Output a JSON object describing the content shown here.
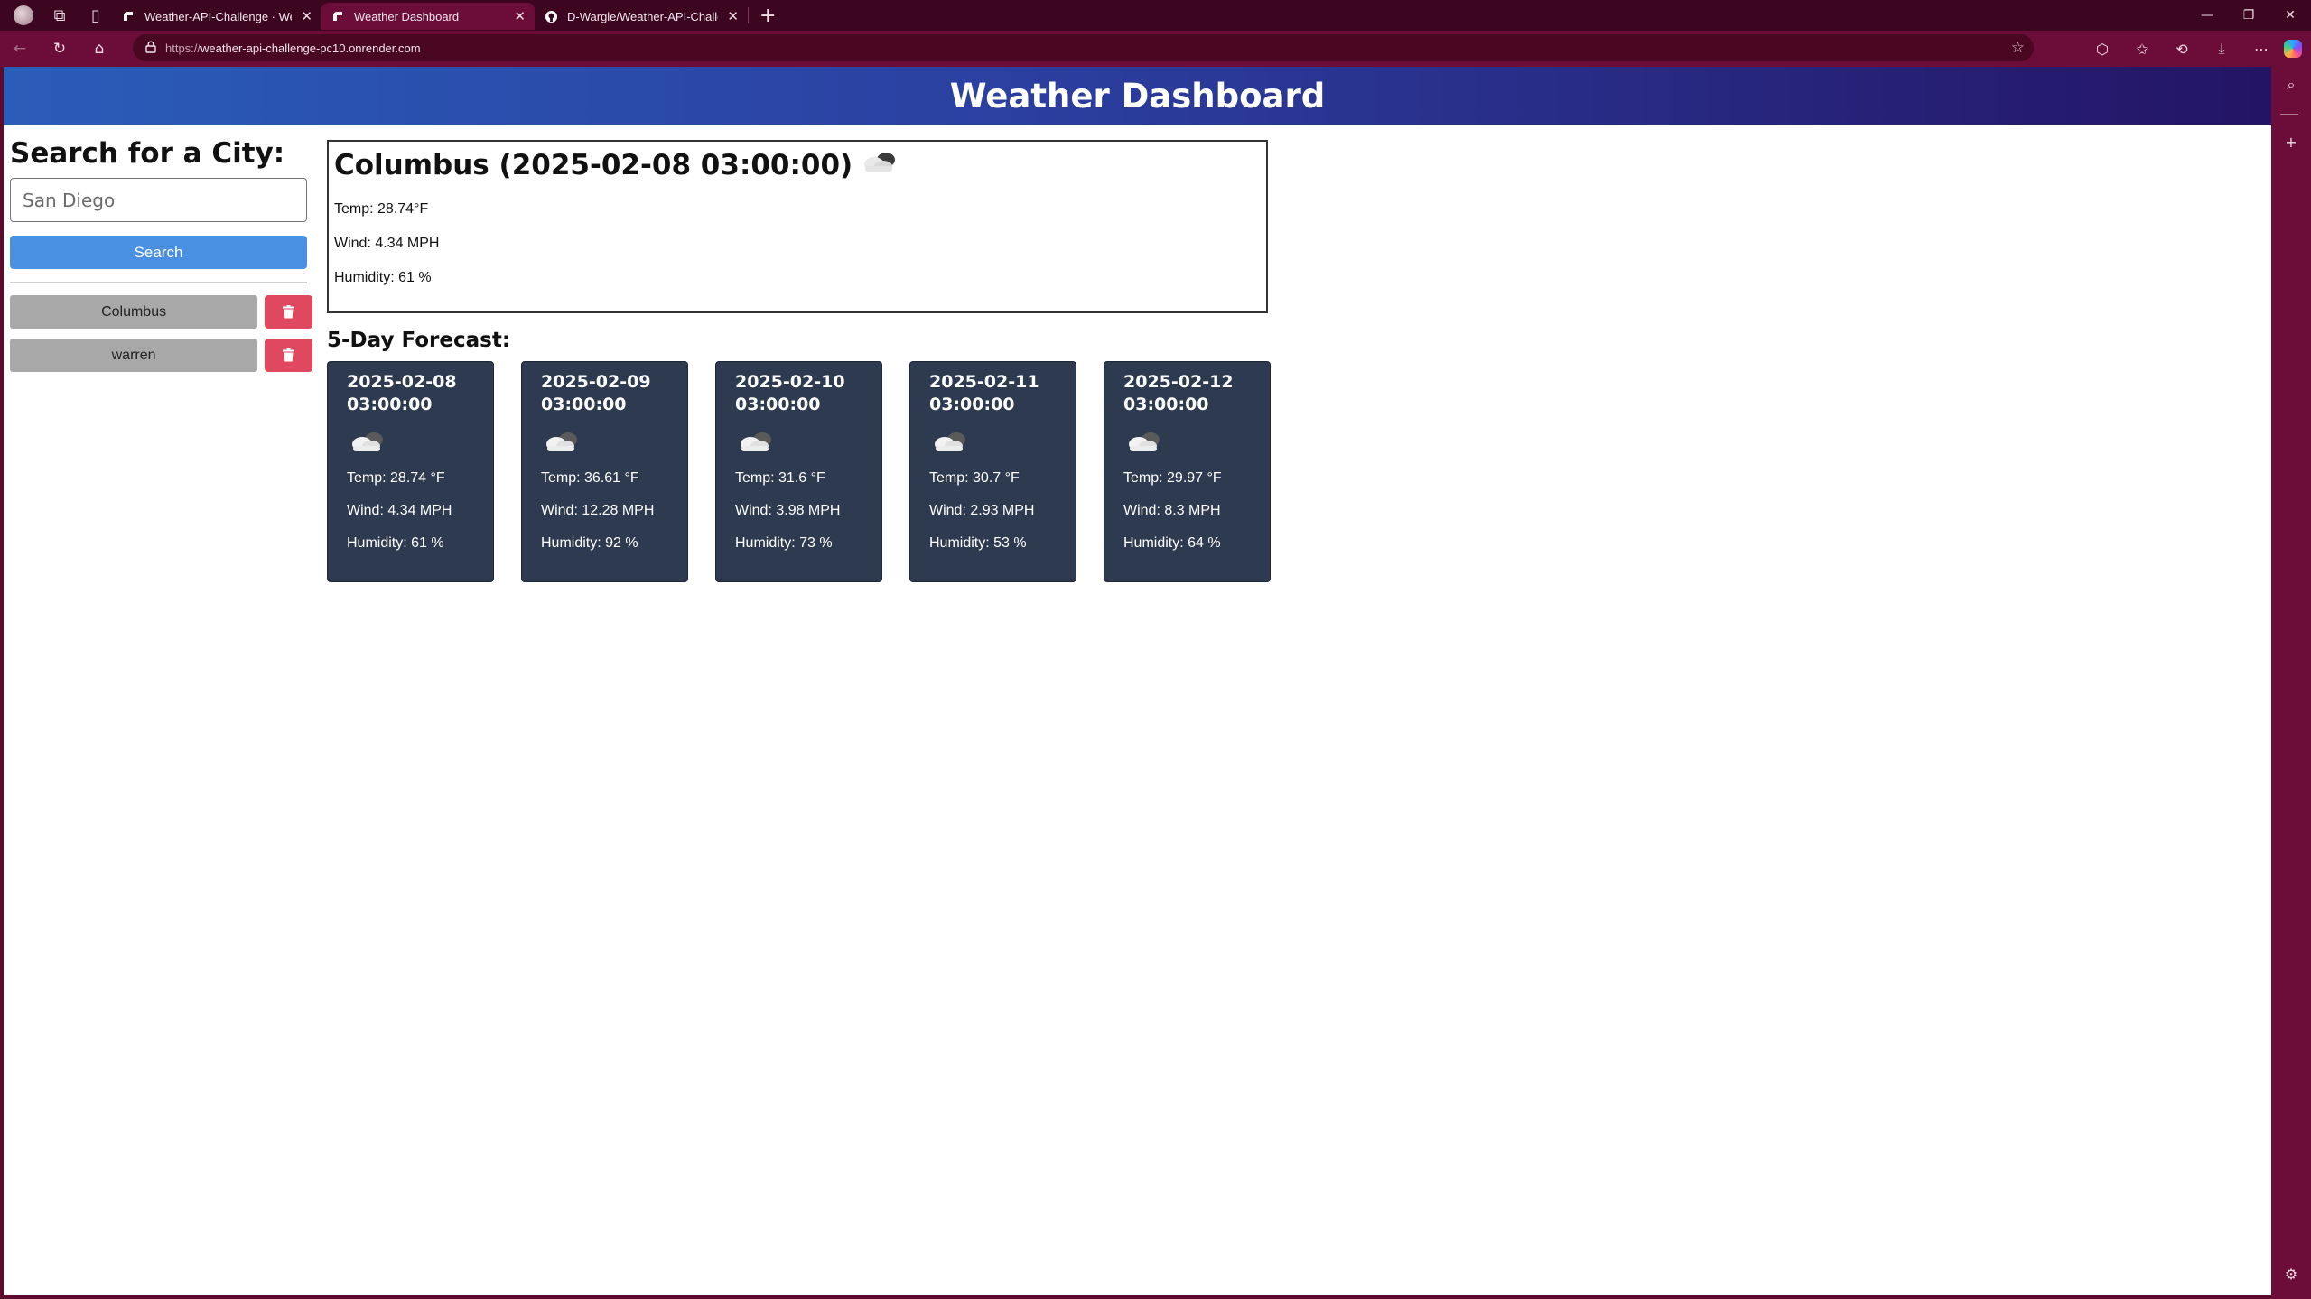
{
  "browser": {
    "tabs": [
      {
        "title": "Weather-API-Challenge · Web Se",
        "active": false,
        "favicon": "render-icon"
      },
      {
        "title": "Weather Dashboard",
        "active": true,
        "favicon": "render-icon"
      },
      {
        "title": "D-Wargle/Weather-API-Challeng",
        "active": false,
        "favicon": "github-icon"
      }
    ],
    "address": {
      "protocol": "https://",
      "host": "weather-api-challenge-pc10.onrender.com"
    }
  },
  "app": {
    "title": "Weather Dashboard",
    "search": {
      "heading": "Search for a City:",
      "placeholder": "San Diego",
      "button_label": "Search"
    },
    "history": [
      {
        "city": "Columbus"
      },
      {
        "city": "warren"
      }
    ],
    "today": {
      "title": "Columbus (2025-02-08 03:00:00)",
      "icon": "cloud-icon",
      "temp": "Temp: 28.74°F",
      "wind": "Wind: 4.34 MPH",
      "humidity": "Humidity: 61 %"
    },
    "forecast_heading": "5-Day Forecast:",
    "forecast": [
      {
        "date": "2025-02-08",
        "time": "03:00:00",
        "icon": "cloud-icon",
        "temp": "Temp: 28.74 °F",
        "wind": "Wind: 4.34 MPH",
        "humidity": "Humidity: 61 %"
      },
      {
        "date": "2025-02-09",
        "time": "03:00:00",
        "icon": "cloud-icon",
        "temp": "Temp: 36.61 °F",
        "wind": "Wind: 12.28 MPH",
        "humidity": "Humidity: 92 %"
      },
      {
        "date": "2025-02-10",
        "time": "03:00:00",
        "icon": "cloud-icon",
        "temp": "Temp: 31.6 °F",
        "wind": "Wind: 3.98 MPH",
        "humidity": "Humidity: 73 %"
      },
      {
        "date": "2025-02-11",
        "time": "03:00:00",
        "icon": "cloud-icon",
        "temp": "Temp: 30.7 °F",
        "wind": "Wind: 2.93 MPH",
        "humidity": "Humidity: 53 %"
      },
      {
        "date": "2025-02-12",
        "time": "03:00:00",
        "icon": "cloud-icon",
        "temp": "Temp: 29.97 °F",
        "wind": "Wind: 8.3 MPH",
        "humidity": "Humidity: 64 %"
      }
    ]
  },
  "colors": {
    "header_gradient_start": "#2a5cb9",
    "header_gradient_end": "#241465",
    "search_button": "#4a90e2",
    "delete_button": "#e0485f",
    "history_button": "#a8a8a8",
    "forecast_card": "#2d3a4f",
    "browser_frame": "#6b0d38"
  }
}
